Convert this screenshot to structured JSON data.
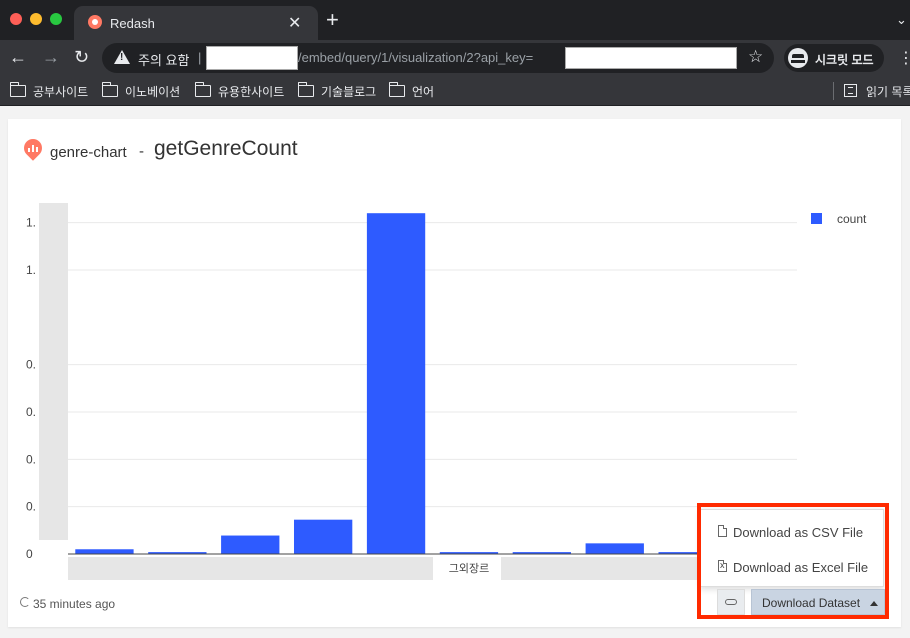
{
  "browser": {
    "tab_title": "Redash",
    "new_tab_glyph": "+",
    "tab_close_glyph": "✕",
    "security_warning": "주의 요함",
    "url_visible": "/embed/query/1/visualization/2?api_key=",
    "incognito_label": "시크릿 모드",
    "bookmarks": [
      {
        "label": "공부사이트"
      },
      {
        "label": "이노베이션"
      },
      {
        "label": "유용한사이트"
      },
      {
        "label": "기술블로그"
      },
      {
        "label": "언어"
      }
    ],
    "reading_list_label": "읽기 목록",
    "colors": {
      "frame": "#202124",
      "toolbar": "#35363a",
      "text": "#e8eaed"
    }
  },
  "page": {
    "query_name": "genre-chart",
    "separator": "-",
    "visualization_name": "getGenreCount",
    "refresh_text": "35 minutes ago",
    "download_button_label": "Download Dataset",
    "download_menu": [
      {
        "label": "Download as CSV File",
        "icon": "file-icon"
      },
      {
        "label": "Download as Excel File",
        "icon": "excel-file-icon"
      }
    ]
  },
  "chart_data": {
    "type": "bar",
    "y_tick_labels": [
      "0",
      "0.",
      "0.",
      "0.",
      "0.",
      "1.",
      "1."
    ],
    "y_tick_values": [
      0,
      0.2,
      0.4,
      0.6,
      0.8,
      1.2,
      1.4
    ],
    "ylim": [
      0,
      1.5
    ],
    "categories_visible": [
      "",
      "",
      "",
      "",
      "",
      "그외장르",
      "",
      "",
      "",
      ""
    ],
    "series": [
      {
        "name": "count",
        "color": "#2e5bff",
        "values": [
          0.02,
          0.008,
          0.078,
          0.145,
          1.44,
          0.008,
          0.008,
          0.045,
          0.008,
          0.008
        ]
      }
    ],
    "legend_position": "top-right",
    "grid": true
  }
}
